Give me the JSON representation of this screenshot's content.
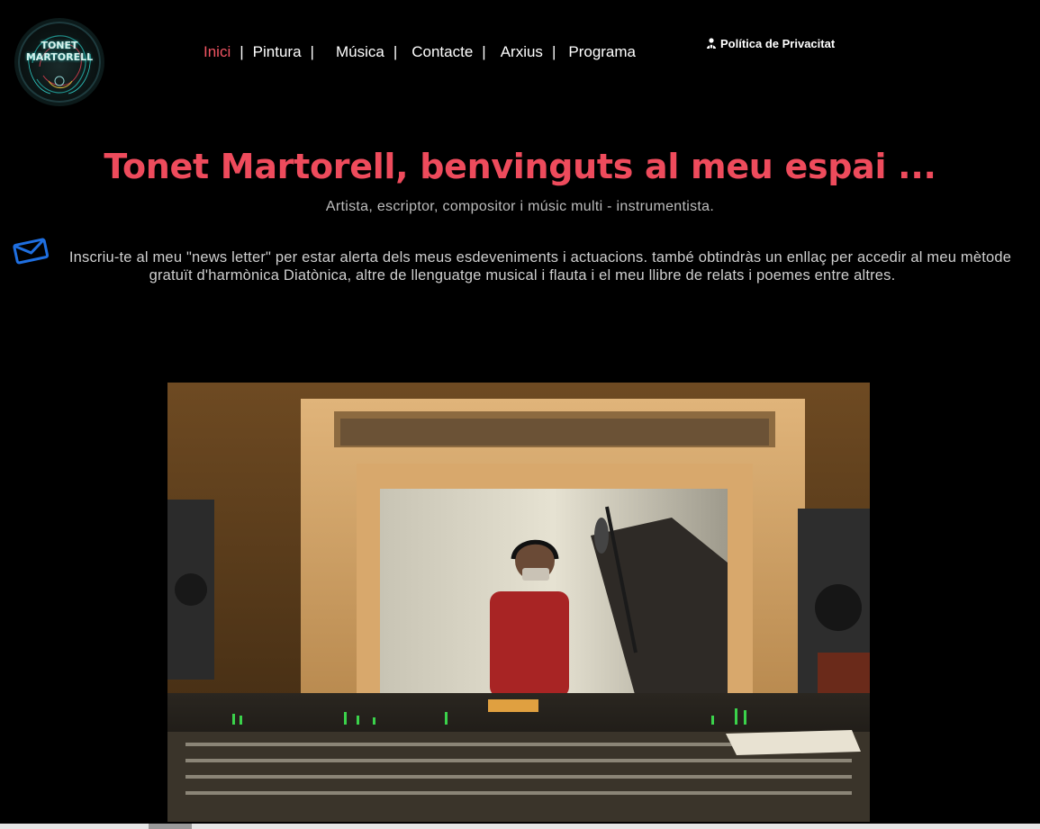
{
  "logo": {
    "line1": "TONET",
    "line2": "MARTORELL"
  },
  "nav": {
    "items": [
      {
        "label": "Inici",
        "active": true
      },
      {
        "label": "Pintura",
        "active": false
      },
      {
        "label": "Música",
        "active": false
      },
      {
        "label": "Contacte",
        "active": false
      },
      {
        "label": "Arxius",
        "active": false
      },
      {
        "label": "Programa",
        "active": false
      }
    ],
    "separator": "|",
    "privacy_label": "Política de Privacitat",
    "privacy_icon": "user-shield-icon"
  },
  "hero": {
    "title": "Tonet Martorell, benvinguts al meu espai ...",
    "subtitle": "Artista, escriptor, compositor i músic multi - instrumentista."
  },
  "newsletter": {
    "icon": "envelope-icon",
    "text": "Inscriu-te al meu \"news letter\" per estar alerta dels meus esdeveniments i actuacions. també obtindràs un enllaç per accedir al meu mètode gratuït d'harmònica Diatònica, altre de llenguatge musical i flauta i el meu llibre de relats i poemes entre altres."
  },
  "colors": {
    "accent": "#ee4b5c",
    "background": "#000000",
    "newsletter_icon": "#1f6fe0"
  }
}
